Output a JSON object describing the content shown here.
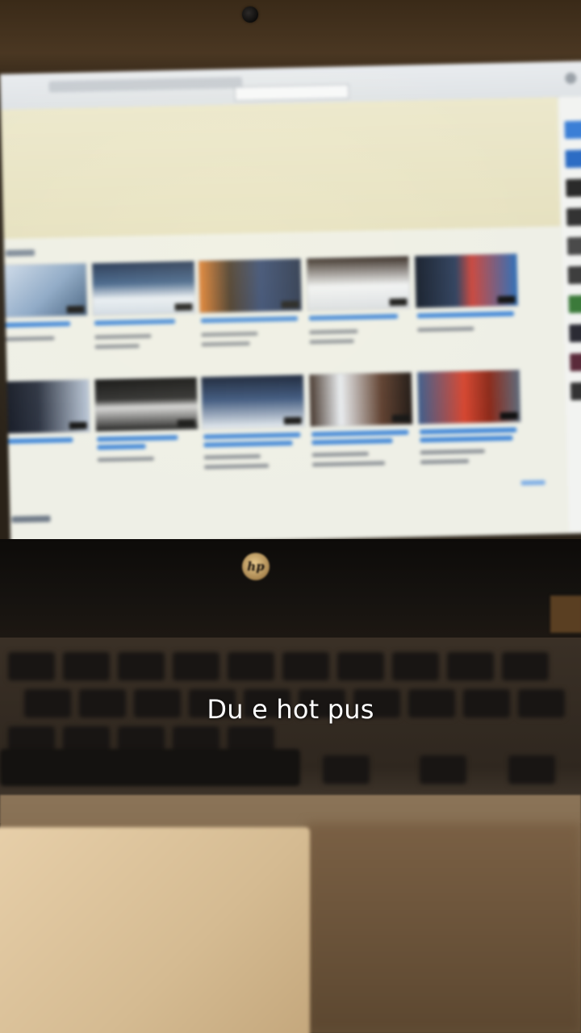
{
  "caption": "Du e hot pus",
  "logo": {
    "text": "hp"
  },
  "colors": {
    "caption_text": "#ffffff",
    "screen_background": "#eeefe6",
    "video_title_link": "#3f86d8",
    "touchpad": "#e2c9a1"
  },
  "icons": [
    "webcam-icon",
    "hp-logo-icon"
  ]
}
